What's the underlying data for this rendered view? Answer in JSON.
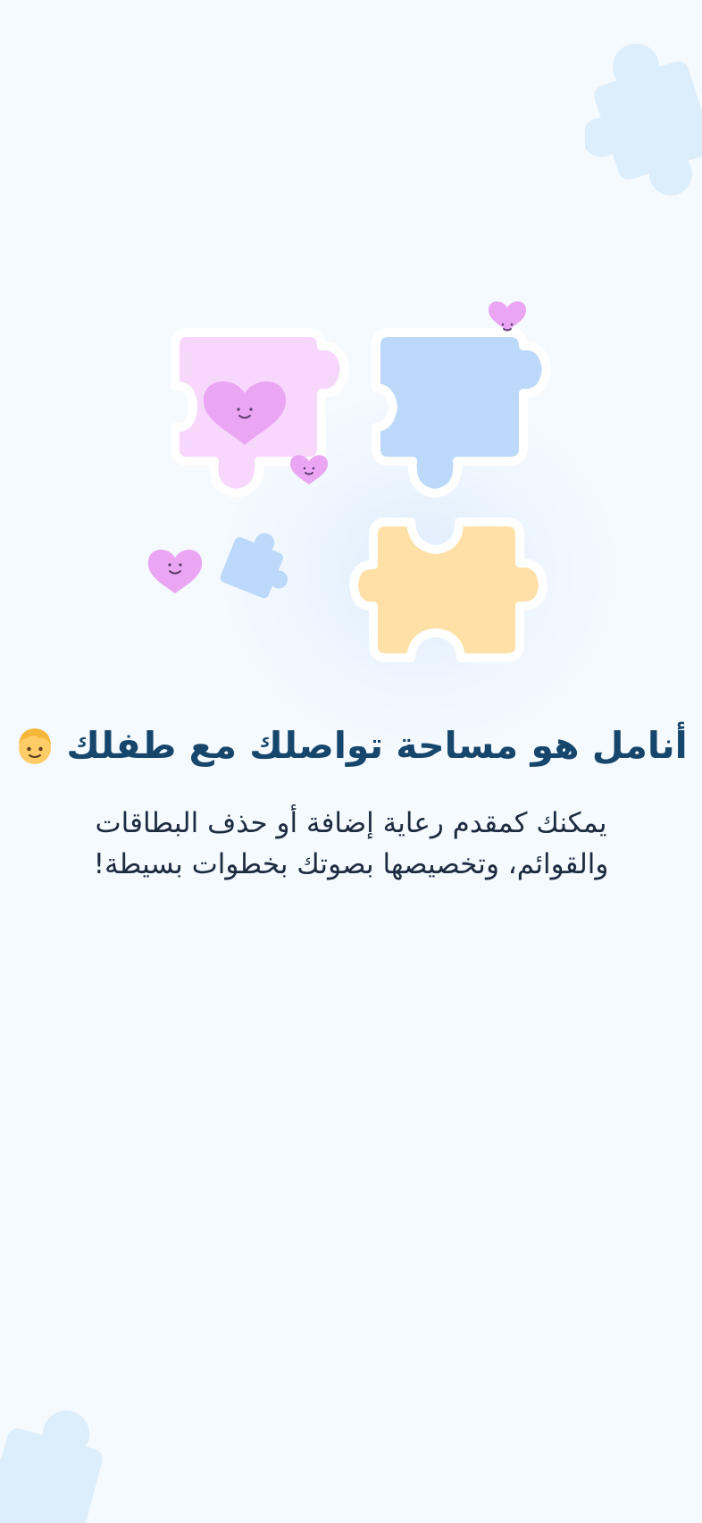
{
  "onboarding": {
    "title": "أنامل هو مساحة تواصلك مع طفلك",
    "description_line_1": "يمكنك كمقدم رعاية إضافة أو حذف البطاقات",
    "description_line_2": "والقوائم، وتخصيصها بصوتك بخطوات بسيطة!"
  },
  "icons": {
    "title_emoji": "child-face-icon",
    "illustration": "puzzle-pieces-icon",
    "hearts": "smiling-heart-icon"
  },
  "colors": {
    "background": "#f5faff",
    "title": "#16466b",
    "body": "#1d2b40",
    "pink_piece": "#f7d7fb",
    "blue_piece": "#bcd9fb",
    "yellow_piece": "#ffe1a8",
    "heart": "#eaa6f2",
    "deco_piece": "#dcedfc"
  }
}
